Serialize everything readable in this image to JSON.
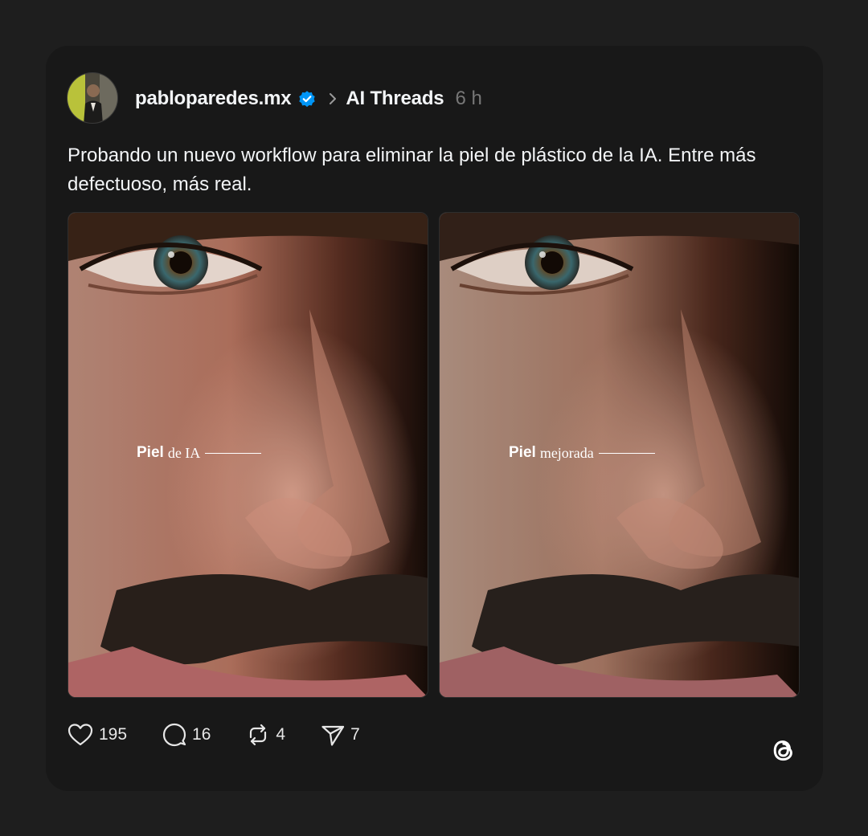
{
  "post": {
    "username": "pabloparedes.mx",
    "community": "AI Threads",
    "time": "6 h",
    "text": "Probando un nuevo workflow para eliminar la piel de plástico de la IA. Entre más defectuoso, más real."
  },
  "media": [
    {
      "label_bold": "Piel",
      "label_rest": "de IA"
    },
    {
      "label_bold": "Piel",
      "label_rest": "mejorada"
    }
  ],
  "actions": {
    "likes": "195",
    "comments": "16",
    "reposts": "4",
    "shares": "7"
  },
  "icons": {
    "verified": "verified-badge-icon",
    "chevron": "chevron-right-icon",
    "like": "heart-icon",
    "comment": "comment-bubble-icon",
    "repost": "repost-icon",
    "share": "send-icon",
    "brand": "threads-logo-icon"
  },
  "colors": {
    "background": "#1e1e1e",
    "card": "#181818",
    "text": "#f3f5f7",
    "muted": "#777777",
    "verified": "#0095f6"
  }
}
